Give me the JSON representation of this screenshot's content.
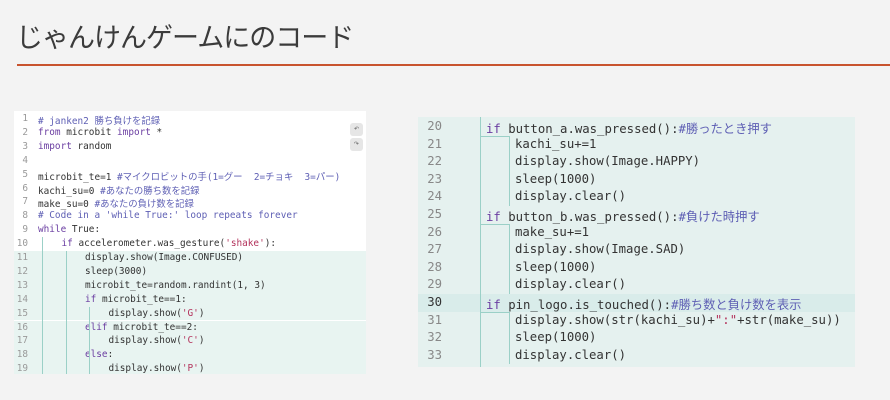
{
  "page": {
    "title": "じゃんけんゲームにのコード"
  },
  "left_editor": {
    "undo_icon": "undo-icon",
    "redo_icon": "redo-icon",
    "lines": [
      {
        "num": "1",
        "tokens": [
          {
            "t": "# janken2 勝ち負けを記録",
            "c": "cm"
          }
        ]
      },
      {
        "num": "2",
        "tokens": [
          {
            "t": "from",
            "c": "kw"
          },
          {
            "t": " microbit ",
            "c": ""
          },
          {
            "t": "import",
            "c": "kw"
          },
          {
            "t": " *",
            "c": ""
          }
        ]
      },
      {
        "num": "3",
        "tokens": [
          {
            "t": "import",
            "c": "kw"
          },
          {
            "t": " random",
            "c": ""
          }
        ]
      },
      {
        "num": "4",
        "tokens": []
      },
      {
        "num": "5",
        "tokens": [
          {
            "t": "microbit_te=1 ",
            "c": ""
          },
          {
            "t": "#マイクロビットの手(1=グー  2=チョキ  3=パー)",
            "c": "cm"
          }
        ]
      },
      {
        "num": "6",
        "tokens": [
          {
            "t": "kachi_su=0 ",
            "c": ""
          },
          {
            "t": "#あなたの勝ち数を記録",
            "c": "cm"
          }
        ]
      },
      {
        "num": "7",
        "tokens": [
          {
            "t": "make_su=0 ",
            "c": ""
          },
          {
            "t": "#あなたの負け数を記録",
            "c": "cm"
          }
        ]
      },
      {
        "num": "8",
        "tokens": [
          {
            "t": "# Code in a 'while True:' loop repeats forever",
            "c": "cm"
          }
        ]
      },
      {
        "num": "9",
        "tokens": [
          {
            "t": "while",
            "c": "kw"
          },
          {
            "t": " True:",
            "c": ""
          }
        ]
      },
      {
        "num": "10",
        "tokens": [
          {
            "t": "if",
            "c": "kw"
          },
          {
            "t": " accelerometer.was_gesture(",
            "c": ""
          },
          {
            "t": "'shake'",
            "c": "st"
          },
          {
            "t": "):",
            "c": ""
          }
        ]
      },
      {
        "num": "11",
        "tokens": [
          {
            "t": "display.show(Image.CONFUSED)",
            "c": ""
          }
        ]
      },
      {
        "num": "12",
        "tokens": [
          {
            "t": "sleep(3000)",
            "c": ""
          }
        ]
      },
      {
        "num": "13",
        "tokens": [
          {
            "t": "microbit_te=random.randint(1, 3)",
            "c": ""
          }
        ]
      },
      {
        "num": "14",
        "tokens": [
          {
            "t": "if",
            "c": "kw"
          },
          {
            "t": " microbit_te==1:",
            "c": ""
          }
        ]
      },
      {
        "num": "15",
        "tokens": [
          {
            "t": "display.show(",
            "c": ""
          },
          {
            "t": "'G'",
            "c": "st"
          },
          {
            "t": ")",
            "c": ""
          }
        ]
      },
      {
        "num": "16",
        "tokens": [
          {
            "t": "elif",
            "c": "kw"
          },
          {
            "t": " microbit_te==2:",
            "c": ""
          }
        ]
      },
      {
        "num": "17",
        "tokens": [
          {
            "t": "display.show(",
            "c": ""
          },
          {
            "t": "'C'",
            "c": "st"
          },
          {
            "t": ")",
            "c": ""
          }
        ]
      },
      {
        "num": "18",
        "tokens": [
          {
            "t": "else",
            "c": "kw"
          },
          {
            "t": ":",
            "c": ""
          }
        ]
      },
      {
        "num": "19",
        "tokens": [
          {
            "t": "display.show(",
            "c": ""
          },
          {
            "t": "'P'",
            "c": "st"
          },
          {
            "t": ")",
            "c": ""
          }
        ]
      }
    ]
  },
  "right_editor": {
    "lines": [
      {
        "num": "20",
        "tokens": [
          {
            "t": "if",
            "c": "kw"
          },
          {
            "t": " button_a.was_pressed():",
            "c": ""
          },
          {
            "t": "#勝ったとき押す",
            "c": "cm"
          }
        ]
      },
      {
        "num": "21",
        "tokens": [
          {
            "t": "kachi_su+=1",
            "c": ""
          }
        ]
      },
      {
        "num": "22",
        "tokens": [
          {
            "t": "display.show(Image.HAPPY)",
            "c": ""
          }
        ]
      },
      {
        "num": "23",
        "tokens": [
          {
            "t": "sleep(1000)",
            "c": ""
          }
        ]
      },
      {
        "num": "24",
        "tokens": [
          {
            "t": "display.clear()",
            "c": ""
          }
        ]
      },
      {
        "num": "25",
        "tokens": [
          {
            "t": "if",
            "c": "kw"
          },
          {
            "t": " button_b.was_pressed():",
            "c": ""
          },
          {
            "t": "#負けた時押す",
            "c": "cm"
          }
        ]
      },
      {
        "num": "26",
        "tokens": [
          {
            "t": "make_su+=1",
            "c": ""
          }
        ]
      },
      {
        "num": "27",
        "tokens": [
          {
            "t": "display.show(Image.SAD)",
            "c": ""
          }
        ]
      },
      {
        "num": "28",
        "tokens": [
          {
            "t": "sleep(1000)",
            "c": ""
          }
        ]
      },
      {
        "num": "29",
        "tokens": [
          {
            "t": "display.clear()",
            "c": ""
          }
        ]
      },
      {
        "num": "30",
        "tokens": [
          {
            "t": "if",
            "c": "kw"
          },
          {
            "t": " pin_logo.is_touched():",
            "c": ""
          },
          {
            "t": "#勝ち数と負け数を表示",
            "c": "cm"
          }
        ]
      },
      {
        "num": "31",
        "tokens": [
          {
            "t": "display.show(str(kachi_su)+",
            "c": ""
          },
          {
            "t": "\":\"",
            "c": "st"
          },
          {
            "t": "+str(make_su))",
            "c": ""
          }
        ]
      },
      {
        "num": "32",
        "tokens": [
          {
            "t": "sleep(1000)",
            "c": ""
          }
        ]
      },
      {
        "num": "33",
        "tokens": [
          {
            "t": "display.clear()",
            "c": ""
          }
        ]
      }
    ]
  }
}
